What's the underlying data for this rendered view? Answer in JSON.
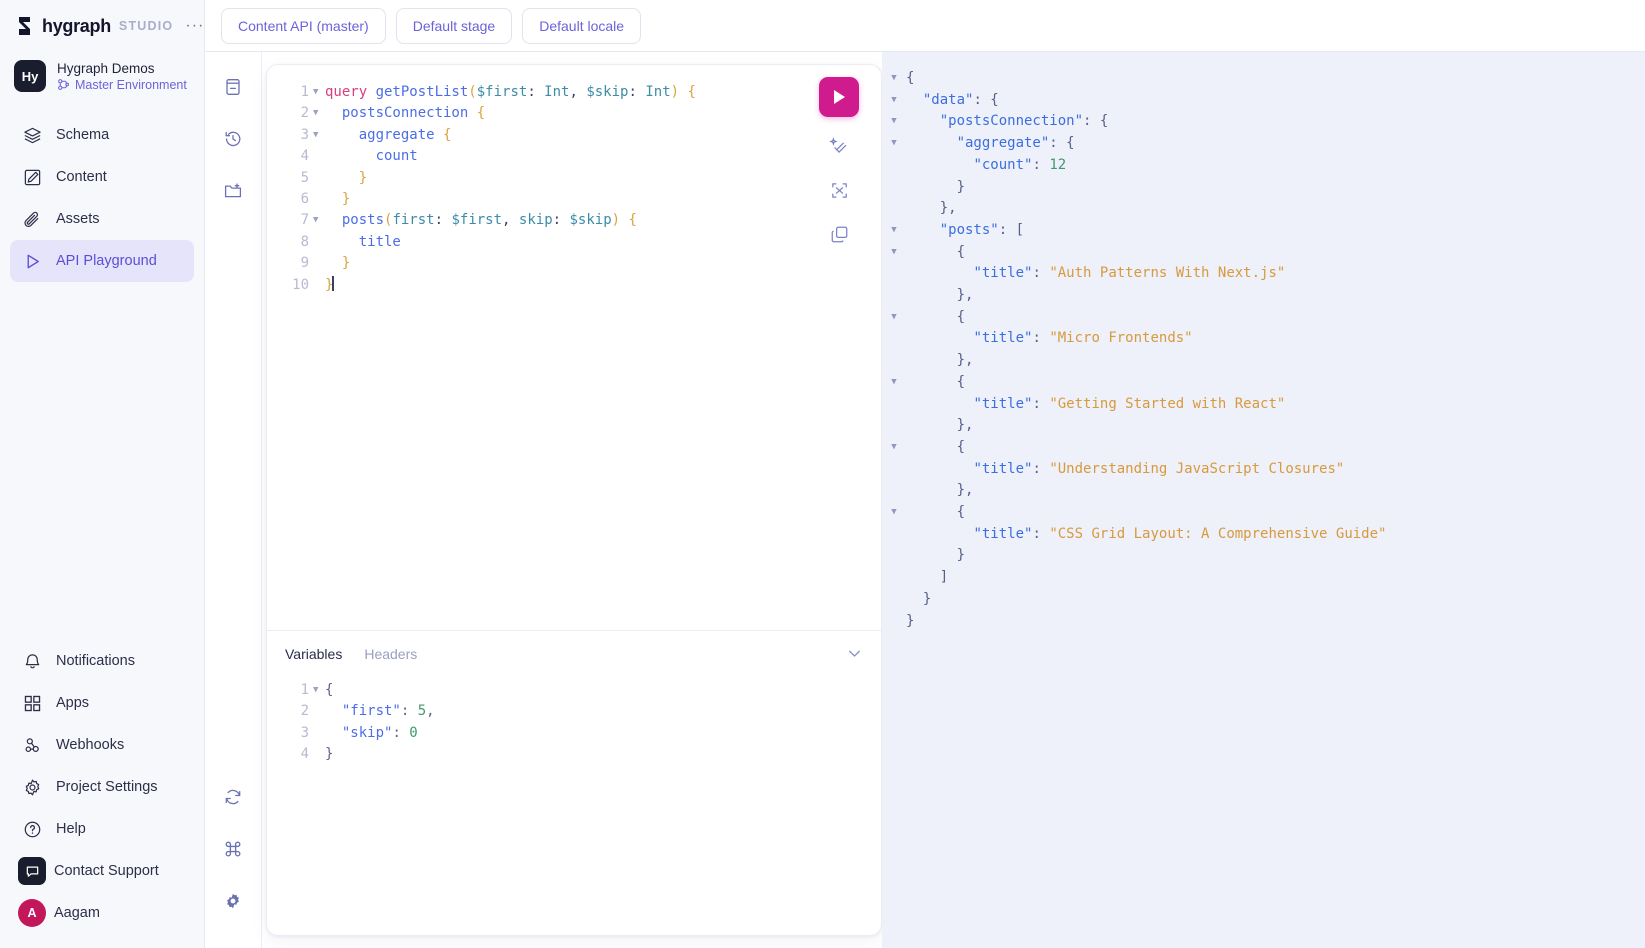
{
  "brand": {
    "name": "hygraph",
    "studio": "STUDIO",
    "dots": "···",
    "logo_icon": "hygraph-logo-icon",
    "menu_icon": "more-options-icon"
  },
  "project": {
    "avatar_initials": "Hy",
    "title": "Hygraph Demos",
    "environment": "Master Environment",
    "env_icon": "branch-icon"
  },
  "sidebar": {
    "primary": [
      {
        "label": "Schema",
        "icon": "layers-icon",
        "active": false
      },
      {
        "label": "Content",
        "icon": "edit-box-icon",
        "active": false
      },
      {
        "label": "Assets",
        "icon": "paperclip-icon",
        "active": false
      },
      {
        "label": "API Playground",
        "icon": "play-icon",
        "active": true
      }
    ],
    "secondary": [
      {
        "label": "Notifications",
        "icon": "bell-icon"
      },
      {
        "label": "Apps",
        "icon": "grid-icon"
      },
      {
        "label": "Webhooks",
        "icon": "webhook-icon"
      },
      {
        "label": "Project Settings",
        "icon": "gear-icon"
      },
      {
        "label": "Help",
        "icon": "question-circle-icon"
      }
    ],
    "support": {
      "label": "Contact Support",
      "icon": "chat-bubble-icon"
    },
    "user": {
      "label": "Aagam",
      "initial": "A",
      "icon": "avatar"
    }
  },
  "topbar": {
    "buttons": [
      {
        "label": "Content API (master)",
        "name": "content-api-selector"
      },
      {
        "label": "Default stage",
        "name": "stage-selector"
      },
      {
        "label": "Default locale",
        "name": "locale-selector"
      }
    ]
  },
  "rail": {
    "top": [
      {
        "icon": "docs-icon",
        "name": "rail-docs-button"
      },
      {
        "icon": "history-icon",
        "name": "rail-history-button"
      },
      {
        "icon": "folder-add-icon",
        "name": "rail-saved-queries-button"
      }
    ],
    "bottom": [
      {
        "icon": "refresh-icon",
        "name": "rail-refresh-button"
      },
      {
        "icon": "command-icon",
        "name": "rail-shortcuts-button"
      },
      {
        "icon": "gear-icon",
        "name": "rail-settings-button"
      }
    ]
  },
  "query_editor": {
    "tools": [
      {
        "icon": "play-icon",
        "name": "execute-query-button"
      },
      {
        "icon": "prettify-icon",
        "name": "prettify-query-button"
      },
      {
        "icon": "merge-icon",
        "name": "merge-fragments-button"
      },
      {
        "icon": "copy-icon",
        "name": "copy-query-button"
      }
    ],
    "lines": [
      {
        "n": "1",
        "fold": true,
        "tokens": [
          {
            "t": "query ",
            "c": "t-kw"
          },
          {
            "t": "getPostList",
            "c": "t-name"
          },
          {
            "t": "(",
            "c": "t-pun"
          },
          {
            "t": "$first",
            "c": "t-var"
          },
          {
            "t": ": ",
            "c": "t-pun2"
          },
          {
            "t": "Int",
            "c": "t-type"
          },
          {
            "t": ", ",
            "c": "t-pun2"
          },
          {
            "t": "$skip",
            "c": "t-var"
          },
          {
            "t": ": ",
            "c": "t-pun2"
          },
          {
            "t": "Int",
            "c": "t-type"
          },
          {
            "t": ")",
            "c": "t-pun"
          },
          {
            "t": " {",
            "c": "t-pun"
          }
        ]
      },
      {
        "n": "2",
        "fold": true,
        "tokens": [
          {
            "t": "  ",
            "c": "t-pun2"
          },
          {
            "t": "postsConnection",
            "c": "t-fld"
          },
          {
            "t": " {",
            "c": "t-pun"
          }
        ]
      },
      {
        "n": "3",
        "fold": true,
        "tokens": [
          {
            "t": "    ",
            "c": "t-pun2"
          },
          {
            "t": "aggregate",
            "c": "t-fld"
          },
          {
            "t": " {",
            "c": "t-pun"
          }
        ]
      },
      {
        "n": "4",
        "fold": false,
        "tokens": [
          {
            "t": "      ",
            "c": "t-pun2"
          },
          {
            "t": "count",
            "c": "t-fld"
          }
        ]
      },
      {
        "n": "5",
        "fold": false,
        "tokens": [
          {
            "t": "    }",
            "c": "t-pun"
          }
        ]
      },
      {
        "n": "6",
        "fold": false,
        "tokens": [
          {
            "t": "  }",
            "c": "t-pun"
          }
        ]
      },
      {
        "n": "7",
        "fold": true,
        "tokens": [
          {
            "t": "  ",
            "c": "t-pun2"
          },
          {
            "t": "posts",
            "c": "t-fld"
          },
          {
            "t": "(",
            "c": "t-pun"
          },
          {
            "t": "first",
            "c": "t-arg"
          },
          {
            "t": ": ",
            "c": "t-pun2"
          },
          {
            "t": "$first",
            "c": "t-var"
          },
          {
            "t": ", ",
            "c": "t-pun2"
          },
          {
            "t": "skip",
            "c": "t-arg"
          },
          {
            "t": ": ",
            "c": "t-pun2"
          },
          {
            "t": "$skip",
            "c": "t-var"
          },
          {
            "t": ")",
            "c": "t-pun"
          },
          {
            "t": " {",
            "c": "t-pun"
          }
        ]
      },
      {
        "n": "8",
        "fold": false,
        "tokens": [
          {
            "t": "    ",
            "c": "t-pun2"
          },
          {
            "t": "title",
            "c": "t-fld"
          }
        ]
      },
      {
        "n": "9",
        "fold": false,
        "tokens": [
          {
            "t": "  }",
            "c": "t-pun"
          }
        ]
      },
      {
        "n": "10",
        "fold": false,
        "caret": true,
        "tokens": [
          {
            "t": "}",
            "c": "t-pun"
          }
        ]
      }
    ]
  },
  "variables_panel": {
    "tabs": [
      {
        "label": "Variables",
        "active": true,
        "name": "tab-variables"
      },
      {
        "label": "Headers",
        "active": false,
        "name": "tab-headers"
      }
    ],
    "collapse_icon": "chevron-down-icon",
    "lines": [
      {
        "n": "1",
        "fold": true,
        "tokens": [
          {
            "t": "{",
            "c": "j-pun"
          }
        ]
      },
      {
        "n": "2",
        "fold": false,
        "tokens": [
          {
            "t": "  ",
            "c": "j-pun"
          },
          {
            "t": "\"first\"",
            "c": "j-key"
          },
          {
            "t": ": ",
            "c": "j-pun"
          },
          {
            "t": "5",
            "c": "j-num"
          },
          {
            "t": ",",
            "c": "j-pun"
          }
        ]
      },
      {
        "n": "3",
        "fold": false,
        "tokens": [
          {
            "t": "  ",
            "c": "j-pun"
          },
          {
            "t": "\"skip\"",
            "c": "j-key"
          },
          {
            "t": ": ",
            "c": "j-pun"
          },
          {
            "t": "0",
            "c": "j-num"
          }
        ]
      },
      {
        "n": "4",
        "fold": false,
        "tokens": [
          {
            "t": "}",
            "c": "j-pun"
          }
        ]
      }
    ]
  },
  "response": {
    "lines": [
      {
        "fold": true,
        "tokens": [
          {
            "t": "{",
            "c": "r-pun"
          }
        ]
      },
      {
        "fold": true,
        "tokens": [
          {
            "t": "  ",
            "c": "r-pun"
          },
          {
            "t": "\"data\"",
            "c": "r-key"
          },
          {
            "t": ": {",
            "c": "r-pun"
          }
        ]
      },
      {
        "fold": true,
        "tokens": [
          {
            "t": "    ",
            "c": "r-pun"
          },
          {
            "t": "\"postsConnection\"",
            "c": "r-key"
          },
          {
            "t": ": {",
            "c": "r-pun"
          }
        ]
      },
      {
        "fold": true,
        "tokens": [
          {
            "t": "      ",
            "c": "r-pun"
          },
          {
            "t": "\"aggregate\"",
            "c": "r-key"
          },
          {
            "t": ": {",
            "c": "r-pun"
          }
        ]
      },
      {
        "fold": false,
        "tokens": [
          {
            "t": "        ",
            "c": "r-pun"
          },
          {
            "t": "\"count\"",
            "c": "r-key"
          },
          {
            "t": ": ",
            "c": "r-pun"
          },
          {
            "t": "12",
            "c": "r-num"
          }
        ]
      },
      {
        "fold": false,
        "tokens": [
          {
            "t": "      }",
            "c": "r-pun"
          }
        ]
      },
      {
        "fold": false,
        "tokens": [
          {
            "t": "    },",
            "c": "r-pun"
          }
        ]
      },
      {
        "fold": true,
        "tokens": [
          {
            "t": "    ",
            "c": "r-pun"
          },
          {
            "t": "\"posts\"",
            "c": "r-key"
          },
          {
            "t": ": [",
            "c": "r-pun"
          }
        ]
      },
      {
        "fold": true,
        "tokens": [
          {
            "t": "      {",
            "c": "r-pun"
          }
        ]
      },
      {
        "fold": false,
        "tokens": [
          {
            "t": "        ",
            "c": "r-pun"
          },
          {
            "t": "\"title\"",
            "c": "r-key"
          },
          {
            "t": ": ",
            "c": "r-pun"
          },
          {
            "t": "\"Auth Patterns With Next.js\"",
            "c": "r-str"
          }
        ]
      },
      {
        "fold": false,
        "tokens": [
          {
            "t": "      },",
            "c": "r-pun"
          }
        ]
      },
      {
        "fold": true,
        "tokens": [
          {
            "t": "      {",
            "c": "r-pun"
          }
        ]
      },
      {
        "fold": false,
        "tokens": [
          {
            "t": "        ",
            "c": "r-pun"
          },
          {
            "t": "\"title\"",
            "c": "r-key"
          },
          {
            "t": ": ",
            "c": "r-pun"
          },
          {
            "t": "\"Micro Frontends\"",
            "c": "r-str"
          }
        ]
      },
      {
        "fold": false,
        "tokens": [
          {
            "t": "      },",
            "c": "r-pun"
          }
        ]
      },
      {
        "fold": true,
        "tokens": [
          {
            "t": "      {",
            "c": "r-pun"
          }
        ]
      },
      {
        "fold": false,
        "tokens": [
          {
            "t": "        ",
            "c": "r-pun"
          },
          {
            "t": "\"title\"",
            "c": "r-key"
          },
          {
            "t": ": ",
            "c": "r-pun"
          },
          {
            "t": "\"Getting Started with React\"",
            "c": "r-str"
          }
        ]
      },
      {
        "fold": false,
        "tokens": [
          {
            "t": "      },",
            "c": "r-pun"
          }
        ]
      },
      {
        "fold": true,
        "tokens": [
          {
            "t": "      {",
            "c": "r-pun"
          }
        ]
      },
      {
        "fold": false,
        "tokens": [
          {
            "t": "        ",
            "c": "r-pun"
          },
          {
            "t": "\"title\"",
            "c": "r-key"
          },
          {
            "t": ": ",
            "c": "r-pun"
          },
          {
            "t": "\"Understanding JavaScript Closures\"",
            "c": "r-str"
          }
        ]
      },
      {
        "fold": false,
        "tokens": [
          {
            "t": "      },",
            "c": "r-pun"
          }
        ]
      },
      {
        "fold": true,
        "tokens": [
          {
            "t": "      {",
            "c": "r-pun"
          }
        ]
      },
      {
        "fold": false,
        "tokens": [
          {
            "t": "        ",
            "c": "r-pun"
          },
          {
            "t": "\"title\"",
            "c": "r-key"
          },
          {
            "t": ": ",
            "c": "r-pun"
          },
          {
            "t": "\"CSS Grid Layout: A Comprehensive Guide\"",
            "c": "r-str"
          }
        ]
      },
      {
        "fold": false,
        "tokens": [
          {
            "t": "      }",
            "c": "r-pun"
          }
        ]
      },
      {
        "fold": false,
        "tokens": [
          {
            "t": "    ]",
            "c": "r-pun"
          }
        ]
      },
      {
        "fold": false,
        "tokens": [
          {
            "t": "  }",
            "c": "r-pun"
          }
        ]
      },
      {
        "fold": false,
        "tokens": [
          {
            "t": "}",
            "c": "r-pun"
          }
        ]
      }
    ]
  },
  "colors": {
    "accent_purple": "#6c63d8",
    "run_pink": "#cf1b8e",
    "sidebar_bg": "#f7f8fc",
    "response_bg": "#eef0fa",
    "active_nav_bg": "#e6e4fb"
  }
}
